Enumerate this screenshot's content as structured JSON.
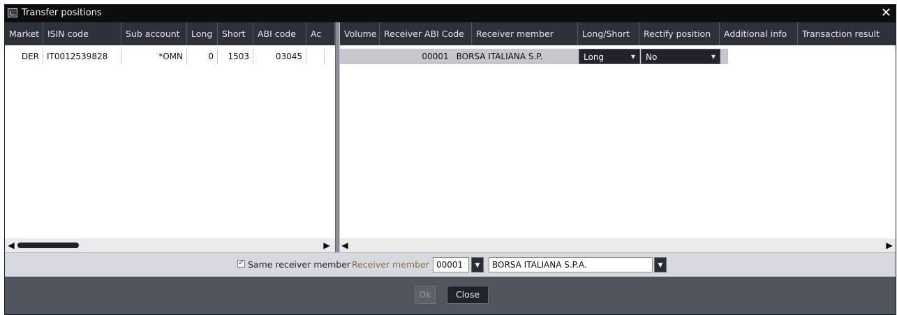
{
  "window": {
    "title": "Transfer positions",
    "close_glyph": "✕"
  },
  "left_table": {
    "headers": [
      "Market",
      "ISIN code",
      "Sub account",
      "Long",
      "Short",
      "ABI code",
      "Ac"
    ],
    "rows": [
      {
        "market": "DER",
        "isin": "IT0012539828",
        "sub_account": "*OMN",
        "long": "0",
        "short": "1503",
        "abi": "03045",
        "ac": ""
      }
    ]
  },
  "right_table": {
    "headers": [
      "Volume",
      "Receiver ABI Code",
      "Receiver member",
      "Long/Short",
      "Rectify position",
      "Additional info",
      "Transaction result"
    ],
    "rows": [
      {
        "volume": "",
        "receiver_abi": "00001",
        "receiver_member": "BORSA ITALIANA S.P.A.",
        "long_short": "Long",
        "rectify": "No",
        "additional_info": "",
        "result": ""
      }
    ]
  },
  "options": {
    "same_receiver_label": "Same receiver member",
    "same_receiver_checked": true,
    "receiver_member_label": "Receiver member",
    "receiver_abi_value": "00001",
    "receiver_name_value": "BORSA ITALIANA S.P.A."
  },
  "buttons": {
    "ok": "Ok",
    "close": "Close"
  },
  "icons": {
    "left_arrow": "◀",
    "right_arrow": "▶",
    "dropdown": "▼"
  },
  "colors": {
    "titlebar": "#0c0d0f",
    "header": "#2d3138",
    "dropdown": "#20242a",
    "label_accent": "#8a6d3b"
  }
}
